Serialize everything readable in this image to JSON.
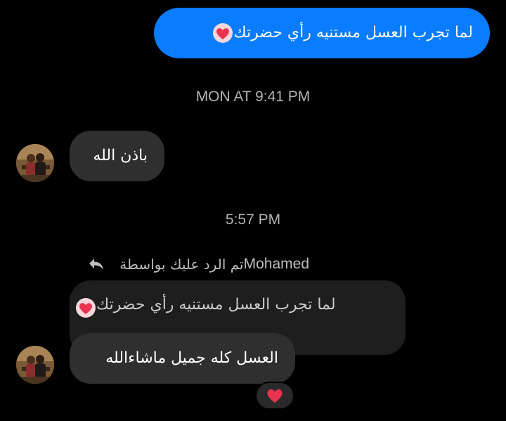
{
  "colors": {
    "background": "#000000",
    "outgoing_bubble": "#0a7cff",
    "incoming_bubble": "#2f2f2f",
    "quoted_bubble": "#1e1e1e",
    "heart": "#e8344e"
  },
  "messages": {
    "outgoing_1": {
      "text": "لما تجرب العسل مستنيه رأي حضرتك",
      "emoji": "heart-emoji"
    },
    "timestamp_1": "MON AT 9:41 PM",
    "incoming_1": {
      "text": "باذن الله"
    },
    "timestamp_2": "5:57 PM",
    "reply_header": {
      "name": "Mohamed",
      "text": "تم الرد عليك بواسطة",
      "icon": "reply-arrow-icon"
    },
    "quoted": {
      "text": "لما تجرب العسل مستنيه رأي حضرتك",
      "emoji": "heart-emoji"
    },
    "incoming_2": {
      "text": "العسل كله جميل ماشاءالله",
      "reaction": "heart-reaction-icon"
    }
  }
}
